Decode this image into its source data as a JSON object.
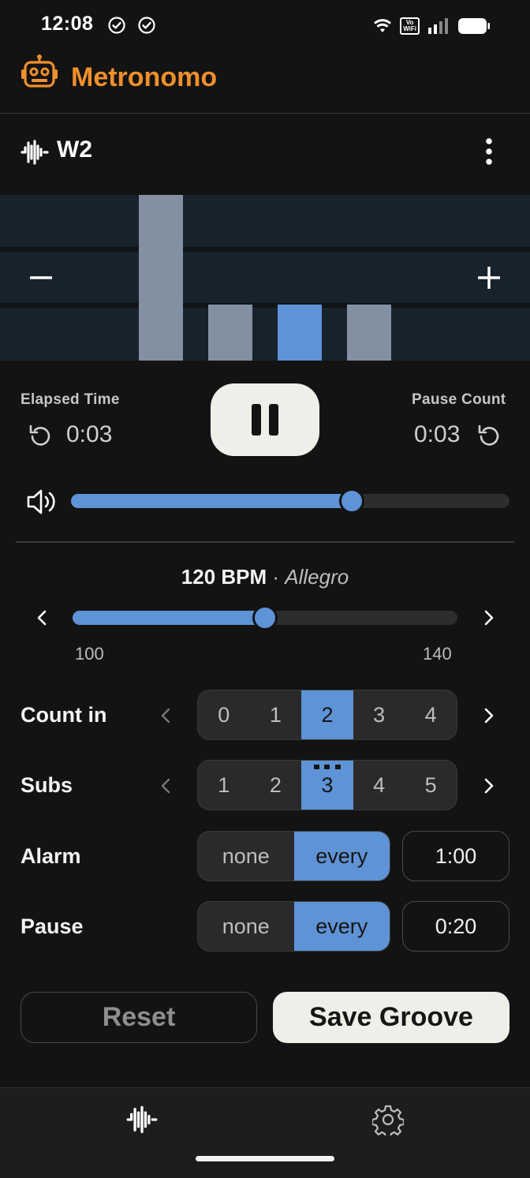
{
  "status_bar": {
    "time": "12:08",
    "network_badge_top": "Vo",
    "network_badge_bottom": "WiFi"
  },
  "app": {
    "title": "Metronomo",
    "accent_color": "#f0902c"
  },
  "groove": {
    "name": "W2"
  },
  "beats": {
    "levels": [
      1.0,
      0.34,
      0.34,
      0.34
    ],
    "active_index": 2,
    "active_color": "#5e93d6",
    "inactive_color": "#8290a2"
  },
  "transport": {
    "elapsed_label": "Elapsed Time",
    "elapsed_value": "0:03",
    "pause_label": "Pause Count",
    "pause_value": "0:03"
  },
  "volume": {
    "level": 0.64
  },
  "tempo": {
    "bpm_text": "120 BPM",
    "separator": " · ",
    "marking": "Allegro",
    "min_label": "100",
    "max_label": "140",
    "min": 100,
    "max": 140,
    "value": 120
  },
  "count_in": {
    "label": "Count in",
    "options": [
      "0",
      "1",
      "2",
      "3",
      "4"
    ],
    "selected_index": 2
  },
  "subs": {
    "label": "Subs",
    "options": [
      "1",
      "2",
      "3",
      "4",
      "5"
    ],
    "selected_index": 2
  },
  "alarm": {
    "label": "Alarm",
    "options": [
      "none",
      "every"
    ],
    "selected_index": 1,
    "interval": "1:00"
  },
  "pause": {
    "label": "Pause",
    "options": [
      "none",
      "every"
    ],
    "selected_index": 1,
    "interval": "0:20"
  },
  "actions": {
    "reset_label": "Reset",
    "save_label": "Save Groove"
  },
  "icons": {
    "robot": "robot-icon",
    "wave": "wave-icon",
    "settings": "gear-icon"
  }
}
